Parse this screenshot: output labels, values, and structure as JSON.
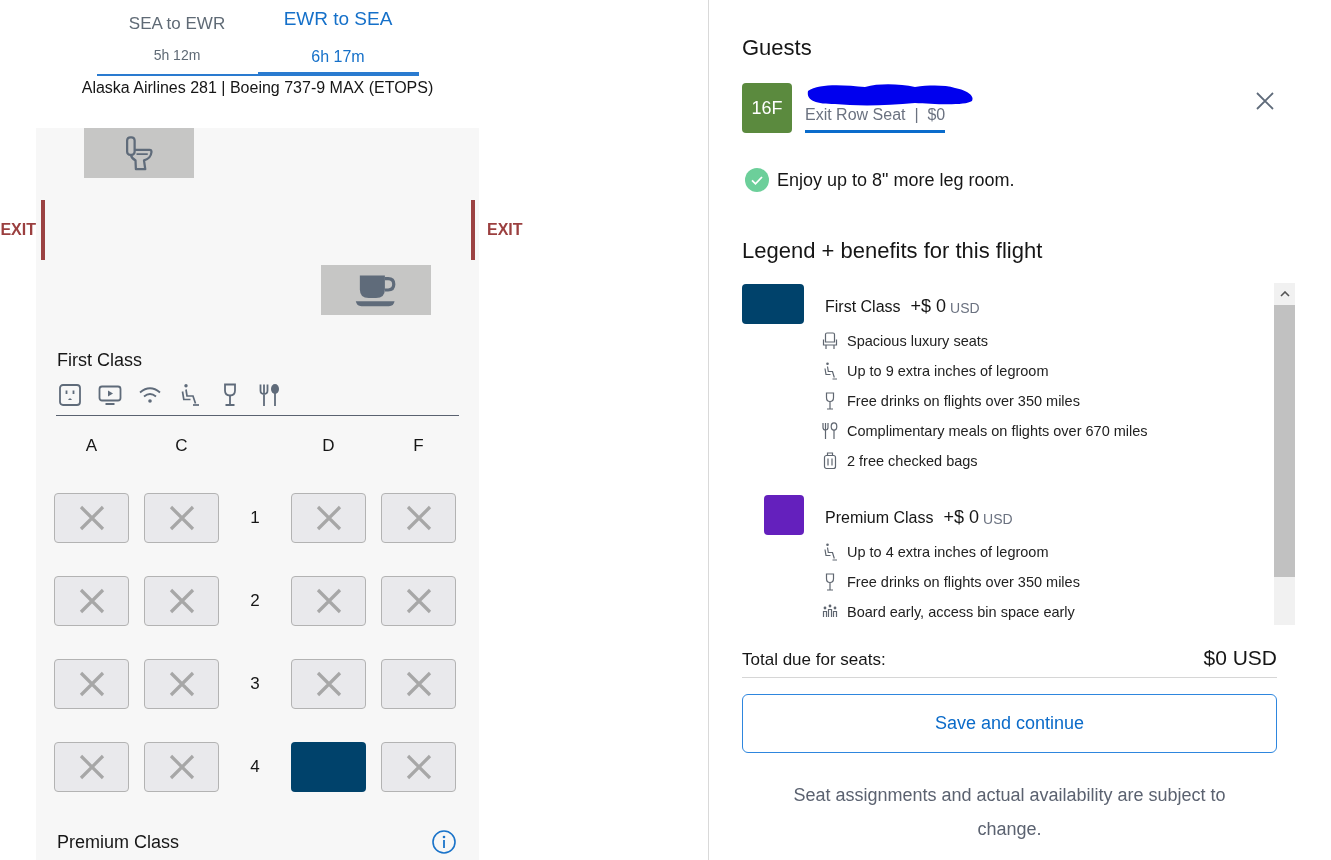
{
  "flight_tabs": [
    {
      "route": "SEA to EWR",
      "duration": "5h 12m",
      "selected": false
    },
    {
      "route": "EWR to SEA",
      "duration": "6h 17m",
      "selected": true
    }
  ],
  "flight_info": "Alaska Airlines 281 | Boeing 737-9 MAX (ETOPS)",
  "seat_map": {
    "exit_left": "EXIT",
    "exit_right": "EXIT",
    "section": {
      "title": "First Class",
      "columns": [
        "A",
        "C",
        "D",
        "F"
      ],
      "rows": [
        {
          "number": "1",
          "seats": [
            {
              "available": false
            },
            {
              "available": false
            },
            {
              "available": false
            },
            {
              "available": false
            }
          ]
        },
        {
          "number": "2",
          "seats": [
            {
              "available": false
            },
            {
              "available": false
            },
            {
              "available": false
            },
            {
              "available": false
            }
          ]
        },
        {
          "number": "3",
          "seats": [
            {
              "available": false
            },
            {
              "available": false
            },
            {
              "available": false
            },
            {
              "available": false
            }
          ]
        },
        {
          "number": "4",
          "seats": [
            {
              "available": false
            },
            {
              "available": false
            },
            {
              "available": true
            },
            {
              "available": false
            }
          ]
        }
      ]
    },
    "next_section": "Premium Class"
  },
  "guests": {
    "title": "Guests",
    "items": [
      {
        "seat": "16F",
        "name_redacted": true,
        "detail": "Exit Row Seat  |  $0",
        "selected": true
      }
    ]
  },
  "benefit_note": "Enjoy up to 8\" more leg room.",
  "legend": {
    "title": "Legend + benefits for this flight",
    "classes": [
      {
        "name": "First Class",
        "price": "+$ 0",
        "currency": "USD",
        "color": "#00426b",
        "kind": "wide",
        "benefits": [
          {
            "kind": "seat",
            "text": "Spacious luxury seats"
          },
          {
            "kind": "legroom",
            "text": "Up to 9 extra inches of legroom"
          },
          {
            "kind": "drink",
            "text": "Free drinks on flights over 350 miles"
          },
          {
            "kind": "meal",
            "text": "Complimentary meals on flights over 670 miles"
          },
          {
            "kind": "bag",
            "text": "2 free checked bags"
          }
        ]
      },
      {
        "name": "Premium Class",
        "price": "+$ 0",
        "currency": "USD",
        "color": "#6420bd",
        "kind": "standard",
        "benefits": [
          {
            "kind": "legroom",
            "text": "Up to 4 extra inches of legroom"
          },
          {
            "kind": "drink",
            "text": "Free drinks on flights over 350 miles"
          },
          {
            "kind": "boarding",
            "text": "Board early, access bin space early"
          }
        ]
      }
    ]
  },
  "total": {
    "label": "Total due for seats:",
    "amount": "$0 USD"
  },
  "save_button": "Save and continue",
  "disclaimer": "Seat assignments and actual availability are subject to change."
}
